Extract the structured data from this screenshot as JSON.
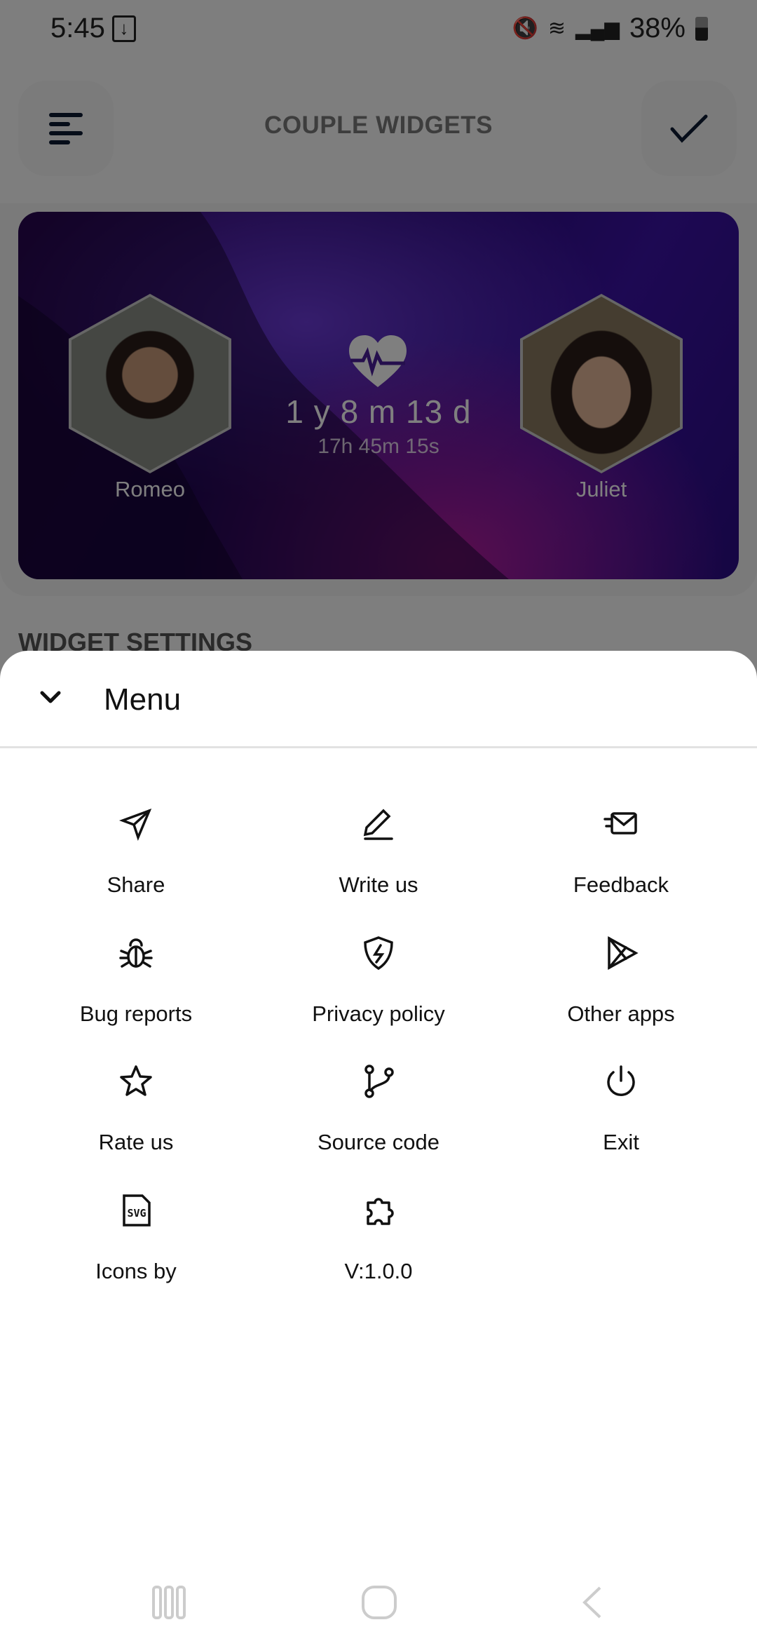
{
  "status_bar": {
    "time": "5:45",
    "battery": "38%"
  },
  "app_bar": {
    "title": "COUPLE WIDGETS",
    "menu_icon": "menu-icon",
    "confirm_icon": "check-icon"
  },
  "widget_card": {
    "left_name": "Romeo",
    "right_name": "Juliet",
    "duration": "1 y 8 m 13 d",
    "time": "17h 45m 15s",
    "icon": "heart-pulse-icon"
  },
  "section_title": "WIDGET SETTINGS",
  "menu": {
    "title": "Menu",
    "items": [
      {
        "label": "Share",
        "icon": "send-icon"
      },
      {
        "label": "Write us",
        "icon": "pencil-icon"
      },
      {
        "label": "Feedback",
        "icon": "mail-fast-icon"
      },
      {
        "label": "Bug reports",
        "icon": "bug-icon"
      },
      {
        "label": "Privacy policy",
        "icon": "shield-bolt-icon"
      },
      {
        "label": "Other apps",
        "icon": "play-store-icon"
      },
      {
        "label": "Rate us",
        "icon": "star-icon"
      },
      {
        "label": "Source code",
        "icon": "git-branch-icon"
      },
      {
        "label": "Exit",
        "icon": "power-icon"
      },
      {
        "label": "Icons by",
        "icon": "svg-icon"
      },
      {
        "label": "V:1.0.0",
        "icon": "puzzle-icon"
      }
    ]
  }
}
